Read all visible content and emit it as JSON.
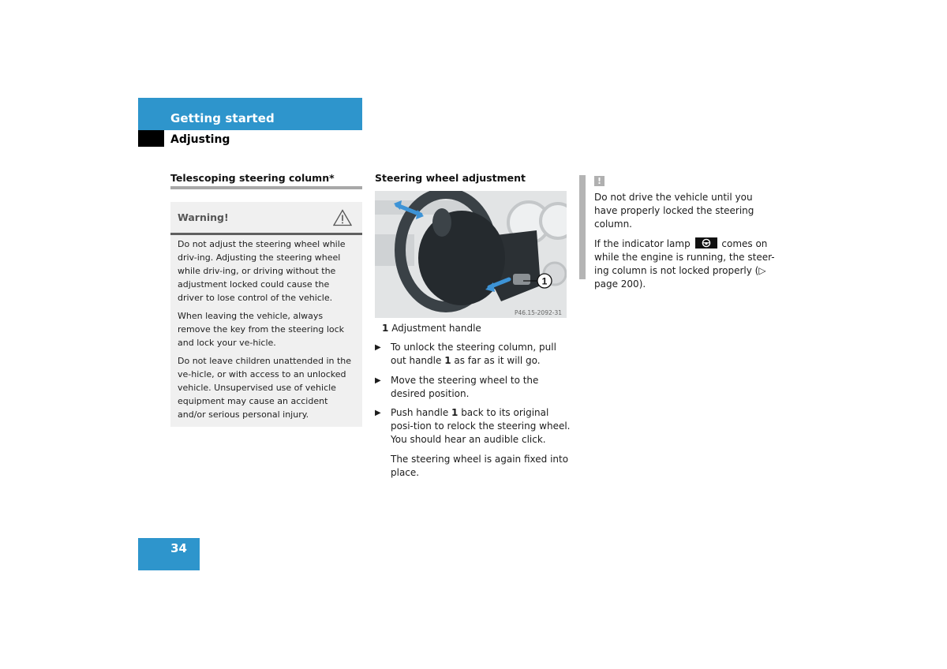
{
  "header": {
    "chapter": "Getting started",
    "section": "Adjusting"
  },
  "left_column": {
    "title": "Telescoping steering column*",
    "warning": {
      "heading": "Warning!",
      "icon": "warning-triangle-icon",
      "paragraphs": [
        "Do not adjust the steering wheel while driv-ing. Adjusting the steering wheel while driv-ing, or driving without the adjustment locked could cause the driver to lose control of the vehicle.",
        "When leaving the vehicle, always remove the key from the steering lock and lock your ve-hicle.",
        "Do not leave children unattended in the ve-hicle, or with access to an unlocked vehicle. Unsupervised use of vehicle equipment may cause an accident and/or serious personal injury."
      ]
    }
  },
  "middle_column": {
    "title": "Steering wheel adjustment",
    "figure": {
      "code": "P46.15-2092-31",
      "callout": "1",
      "alt": "Steering wheel with adjustment arrows and handle 1"
    },
    "legend": {
      "number": "1",
      "label": "Adjustment handle"
    },
    "steps": [
      {
        "before": "To unlock the steering column, pull out handle ",
        "ref": "1",
        "after": " as far as it will go."
      },
      {
        "before": "Move the steering wheel to the desired position.",
        "ref": "",
        "after": ""
      },
      {
        "before": "Push handle ",
        "ref": "1",
        "after": " back to its original posi-tion to relock the steering wheel. You should hear an audible click."
      }
    ],
    "result": "The steering wheel is again fixed into place."
  },
  "right_column": {
    "icon": "exclamation-icon",
    "paragraph1": "Do not drive the vehicle until you have properly locked the steering column.",
    "paragraph2_before": "If the indicator lamp",
    "lamp_icon": "steering-wheel-lamp-icon",
    "paragraph2_after": "comes on while the engine is running, the steer-ing column is not locked properly",
    "page_ref": "(▷ page 200)."
  },
  "footer": {
    "page_number": "34"
  },
  "colors": {
    "accent": "#2e95cc",
    "warning_bg": "#f0f0f0",
    "rule": "#a8a8a8"
  }
}
